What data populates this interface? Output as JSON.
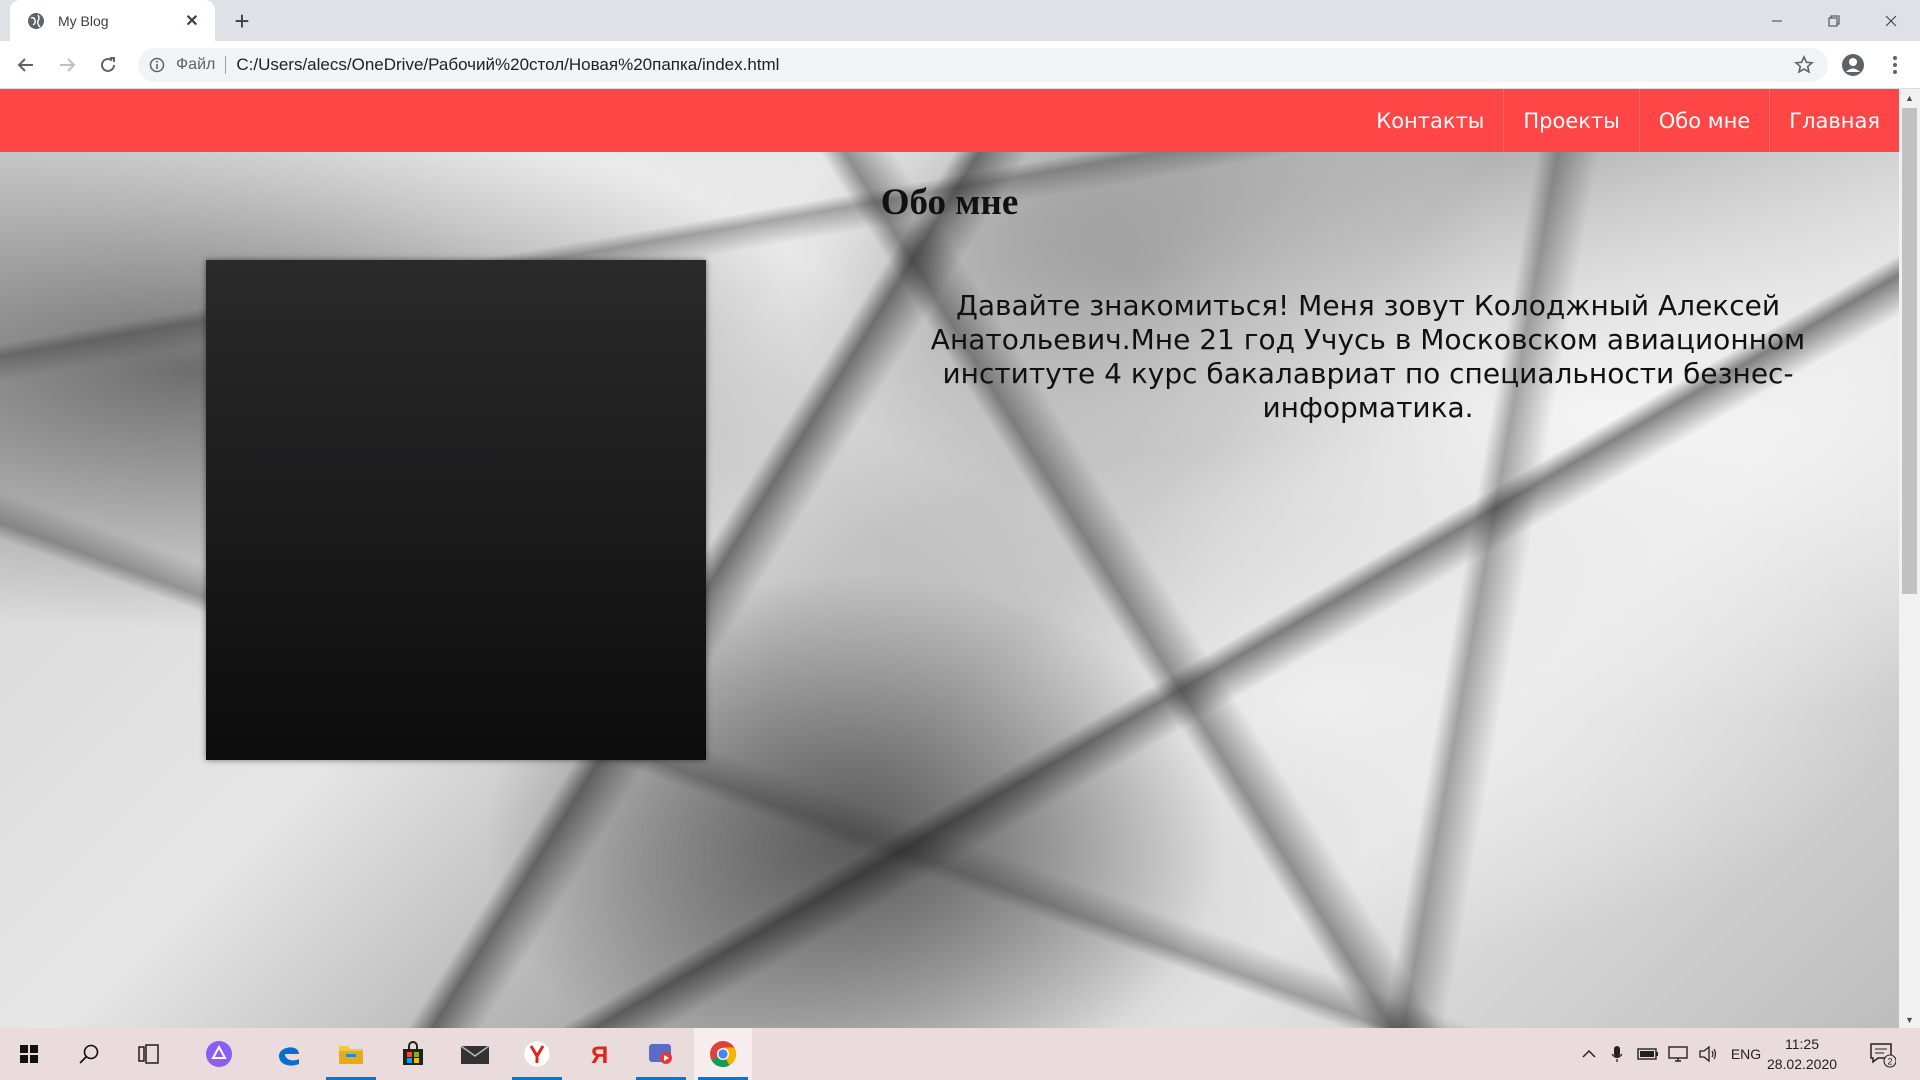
{
  "browser": {
    "tab": {
      "title": "My Blog",
      "close": "✕"
    },
    "new_tab": "+",
    "omnibox": {
      "scheme_label": "Файл",
      "url": "C:/Users/alecs/OneDrive/Рабочий%20стол/Новая%20папка/index.html"
    }
  },
  "page": {
    "nav": [
      {
        "label": "Контакты"
      },
      {
        "label": "Проекты"
      },
      {
        "label": "Обо мне"
      },
      {
        "label": "Главная"
      }
    ],
    "accent_color": "#ff4646",
    "heading": "Обо мне",
    "bio": "Давайте знакомиться! Меня зовут Колоджный Алексей Анатольевич.Мне 21 год Учусь в Московском авиационном институте 4 курс бакалавриат по специальности безнес-информатика."
  },
  "taskbar": {
    "items": [
      {
        "icon": "windows-start-icon"
      },
      {
        "icon": "search-icon"
      },
      {
        "icon": "task-view-icon"
      },
      {
        "icon": "cortana-icon"
      },
      {
        "icon": "edge-icon"
      },
      {
        "icon": "file-explorer-icon"
      },
      {
        "icon": "store-icon"
      },
      {
        "icon": "mail-icon"
      },
      {
        "icon": "yandex-browser-icon"
      },
      {
        "icon": "yandex-icon"
      },
      {
        "icon": "media-app-icon"
      },
      {
        "icon": "chrome-icon"
      }
    ],
    "language": "ENG",
    "time": "11:25",
    "date": "28.02.2020",
    "notification_count": "2"
  }
}
